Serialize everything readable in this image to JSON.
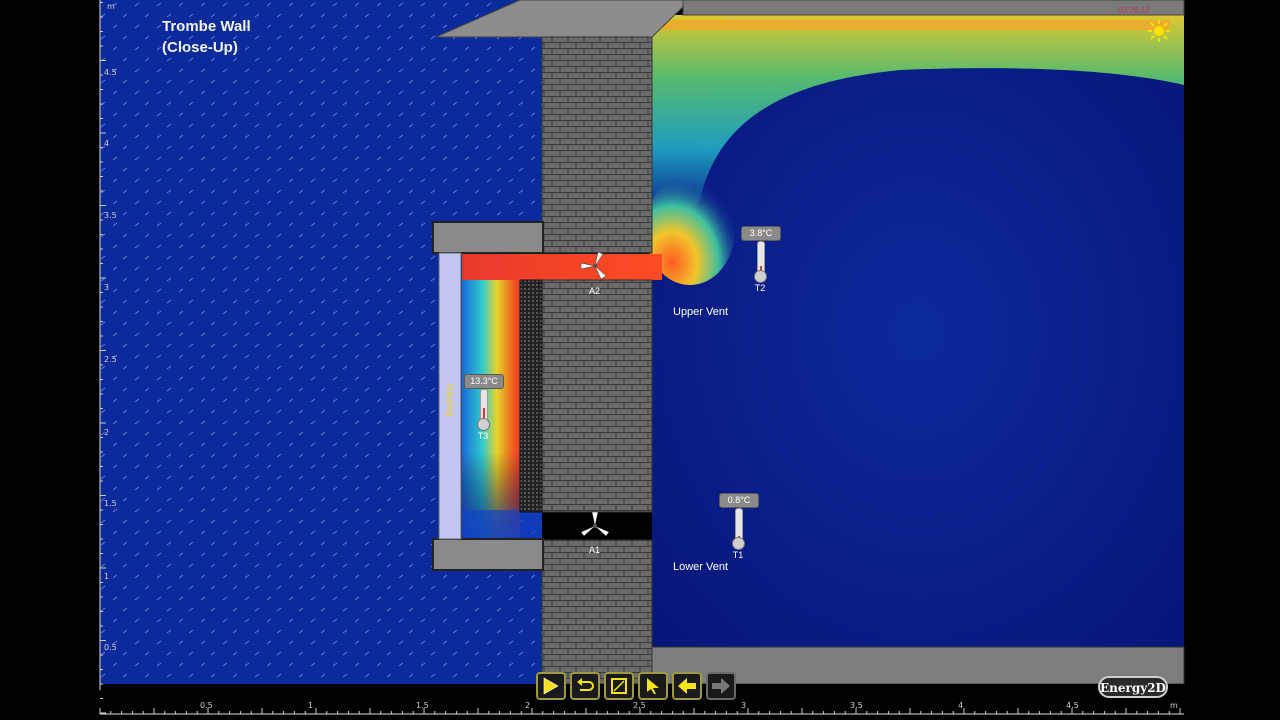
{
  "window": {
    "title": "Trombe Wall",
    "subtitle": "(Close-Up)",
    "timer": "03:26:22"
  },
  "labels": {
    "upper_vent": "Upper Vent",
    "lower_vent": "Lower Vent",
    "glazing": "Glazing"
  },
  "thermometers": [
    {
      "name": "T2",
      "reading": "3.8°C"
    },
    {
      "name": "T3",
      "reading": "13.3°C"
    },
    {
      "name": "T1",
      "reading": "0.8°C"
    }
  ],
  "anemometers": [
    {
      "name": "A2"
    },
    {
      "name": "A1"
    }
  ],
  "rulers": {
    "unit": "m",
    "vertical_ticks": [
      "4.5",
      "4",
      "3.5",
      "3",
      "2.5",
      "2",
      "1.5",
      "1",
      "0.5"
    ],
    "horizontal_ticks": [
      "0.5",
      "1",
      "1.5",
      "2",
      "2.5",
      "3",
      "3.5",
      "4",
      "4.5"
    ]
  },
  "toolbar": {
    "buttons": [
      {
        "name": "run-button",
        "icon": "play-icon"
      },
      {
        "name": "reset-button",
        "icon": "reset-icon"
      },
      {
        "name": "snapshot-button",
        "icon": "snapshot-icon"
      },
      {
        "name": "select-button",
        "icon": "pointer-icon"
      },
      {
        "name": "previous-button",
        "icon": "arrow-left-icon"
      },
      {
        "name": "next-button",
        "icon": "arrow-right-icon"
      }
    ]
  },
  "brand": "Energy2D",
  "colors": {
    "cold": "#001a8c",
    "warm": "#e83a2c",
    "brick": "#5a5a5a",
    "ui_accent": "#9c9a3a",
    "sun": "#ffe100"
  }
}
